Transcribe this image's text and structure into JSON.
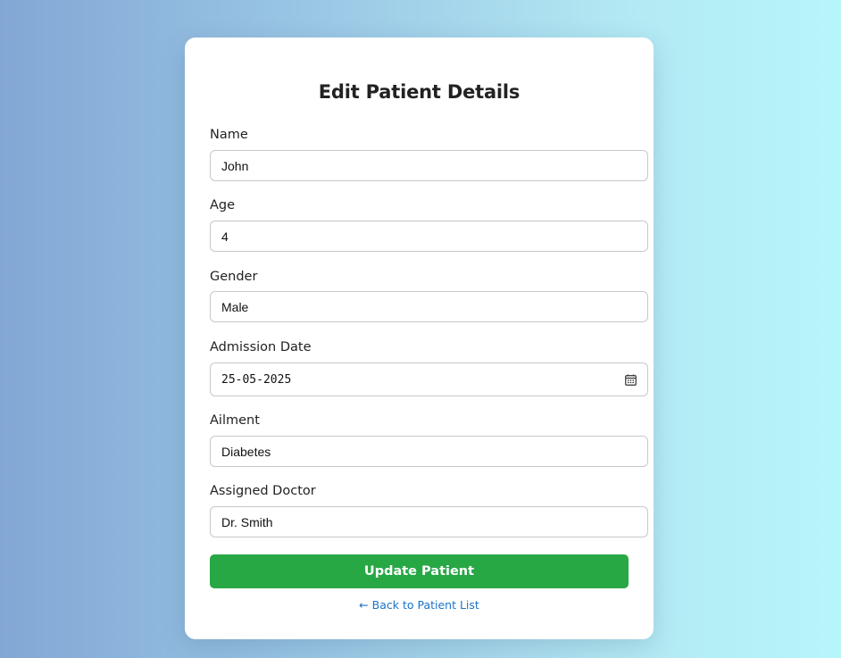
{
  "form": {
    "title": "Edit Patient Details",
    "fields": [
      {
        "label": "Name",
        "value": "John"
      },
      {
        "label": "Age",
        "value": "4"
      },
      {
        "label": "Gender",
        "value": "Male"
      },
      {
        "label": "Admission Date",
        "value": "25-05-2025",
        "icon": "calendar-icon"
      },
      {
        "label": "Ailment",
        "value": "Diabetes"
      },
      {
        "label": "Assigned Doctor",
        "value": "Dr. Smith"
      }
    ],
    "submit_label": "Update Patient",
    "back_link_label": "← Back to Patient List"
  },
  "colors": {
    "primary_button": "#28a745",
    "link": "#1a73c8",
    "background_start": "#83a7d5",
    "background_end": "#b6f6fb"
  }
}
